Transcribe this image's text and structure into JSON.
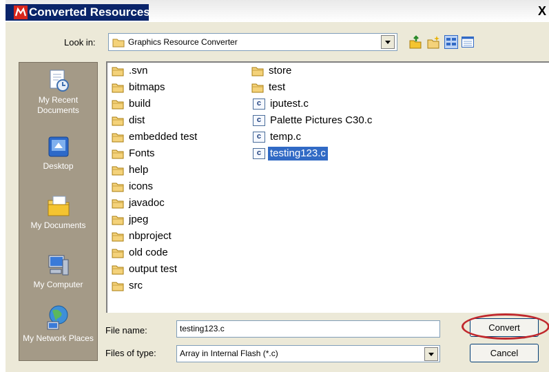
{
  "window": {
    "title": "Converted Resources",
    "close_label": "X"
  },
  "toolbar": {
    "lookin_label": "Look in:",
    "lookin_value": "Graphics Resource Converter",
    "icons": [
      "up-folder-icon",
      "new-folder-icon",
      "list-view-icon",
      "details-view-icon"
    ]
  },
  "places": [
    {
      "label": "My Recent Documents",
      "icon": "recent-documents-icon"
    },
    {
      "label": "Desktop",
      "icon": "desktop-icon"
    },
    {
      "label": "My Documents",
      "icon": "my-documents-icon"
    },
    {
      "label": "My Computer",
      "icon": "my-computer-icon"
    },
    {
      "label": "My Network Places",
      "icon": "network-places-icon"
    }
  ],
  "files": {
    "column1": [
      ".svn",
      "bitmaps",
      "build",
      "dist",
      "embedded test",
      "Fonts",
      "help",
      "icons",
      "javadoc",
      "jpeg",
      "nbproject",
      "old code",
      "output test",
      "src"
    ],
    "column2_folders": [
      "store",
      "test"
    ],
    "column2_files": [
      "iputest.c",
      "Palette Pictures C30.c",
      "temp.c",
      "testing123.c"
    ],
    "c_icon_letter": "c",
    "selected": "testing123.c"
  },
  "form": {
    "filename_label": "File name:",
    "filename_value": "testing123.c",
    "filetype_label": "Files of type:",
    "filetype_value": "Array in Internal Flash (*.c)"
  },
  "buttons": {
    "convert": "Convert",
    "cancel": "Cancel"
  },
  "colors": {
    "title_bar": "#0a246a",
    "places_bar": "#a49a87",
    "selection": "#316ac5",
    "annotation_ring": "#c0282d"
  }
}
